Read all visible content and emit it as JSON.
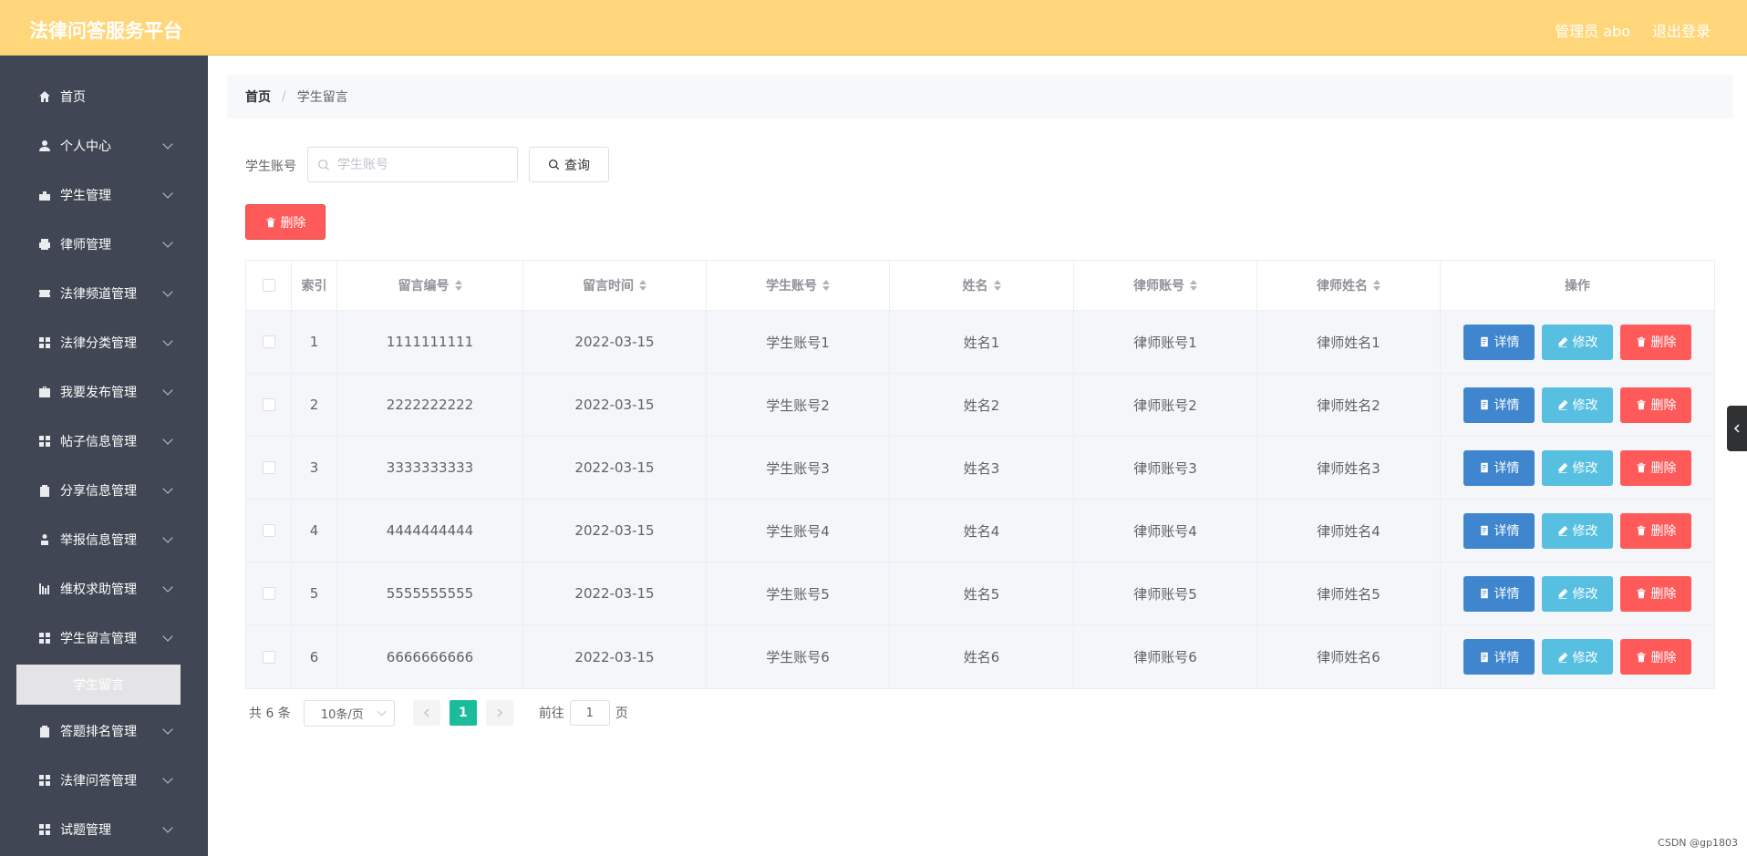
{
  "header": {
    "title": "法律问答服务平台",
    "admin_label": "管理员 abo",
    "logout_label": "退出登录"
  },
  "sidebar": {
    "items": [
      {
        "label": "首页",
        "icon": "home-icon"
      },
      {
        "label": "个人中心",
        "icon": "user-icon"
      },
      {
        "label": "学生管理",
        "icon": "school-icon"
      },
      {
        "label": "律师管理",
        "icon": "printer-icon"
      },
      {
        "label": "法律频道管理",
        "icon": "ticket-icon"
      },
      {
        "label": "法律分类管理",
        "icon": "grid-icon"
      },
      {
        "label": "我要发布管理",
        "icon": "briefcase-icon"
      },
      {
        "label": "帖子信息管理",
        "icon": "grid-icon"
      },
      {
        "label": "分享信息管理",
        "icon": "clipboard-icon"
      },
      {
        "label": "举报信息管理",
        "icon": "person-icon"
      },
      {
        "label": "维权求助管理",
        "icon": "chart-icon"
      },
      {
        "label": "学生留言管理",
        "icon": "grid-icon"
      },
      {
        "label": "答题排名管理",
        "icon": "clipboard-icon"
      },
      {
        "label": "法律问答管理",
        "icon": "grid-icon"
      },
      {
        "label": "试题管理",
        "icon": "grid-icon"
      }
    ],
    "submenu_label": "学生留言"
  },
  "breadcrumb": {
    "home": "首页",
    "separator": "/",
    "current": "学生留言"
  },
  "search": {
    "label": "学生账号",
    "placeholder": "学生账号",
    "value": "",
    "button_label": "查询"
  },
  "toolbar": {
    "delete_label": "删除"
  },
  "table": {
    "columns": [
      "索引",
      "留言编号",
      "留言时间",
      "学生账号",
      "姓名",
      "律师账号",
      "律师姓名",
      "操作"
    ],
    "rows": [
      {
        "index": "1",
        "msg_no": "1111111111",
        "time": "2022-03-15",
        "student": "学生账号1",
        "name": "姓名1",
        "lawyer": "律师账号1",
        "lawyer_name": "律师姓名1"
      },
      {
        "index": "2",
        "msg_no": "2222222222",
        "time": "2022-03-15",
        "student": "学生账号2",
        "name": "姓名2",
        "lawyer": "律师账号2",
        "lawyer_name": "律师姓名2"
      },
      {
        "index": "3",
        "msg_no": "3333333333",
        "time": "2022-03-15",
        "student": "学生账号3",
        "name": "姓名3",
        "lawyer": "律师账号3",
        "lawyer_name": "律师姓名3"
      },
      {
        "index": "4",
        "msg_no": "4444444444",
        "time": "2022-03-15",
        "student": "学生账号4",
        "name": "姓名4",
        "lawyer": "律师账号4",
        "lawyer_name": "律师姓名4"
      },
      {
        "index": "5",
        "msg_no": "5555555555",
        "time": "2022-03-15",
        "student": "学生账号5",
        "name": "姓名5",
        "lawyer": "律师账号5",
        "lawyer_name": "律师姓名5"
      },
      {
        "index": "6",
        "msg_no": "6666666666",
        "time": "2022-03-15",
        "student": "学生账号6",
        "name": "姓名6",
        "lawyer": "律师账号6",
        "lawyer_name": "律师姓名6"
      }
    ],
    "actions": {
      "detail": "详情",
      "edit": "修改",
      "delete": "删除"
    }
  },
  "pagination": {
    "total_label": "共 6 条",
    "page_size": "10条/页",
    "current_page": "1",
    "goto_label": "前往",
    "goto_value": "1",
    "page_suffix": "页"
  },
  "watermark": "CSDN @gp1803",
  "colors": {
    "header": "#ffd77a",
    "sidebar": "#404653",
    "accent": "#1abc9c",
    "danger": "#ff5a5a",
    "primary": "#3f86cf",
    "info": "#57bfe0"
  }
}
